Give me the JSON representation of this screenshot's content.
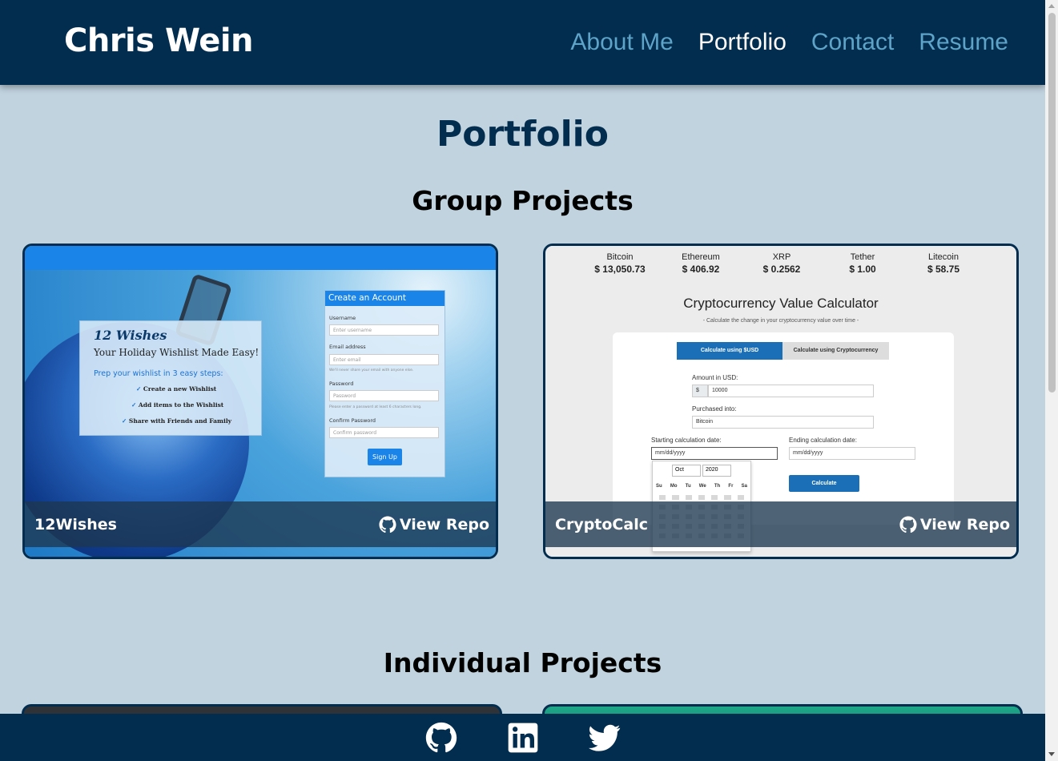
{
  "nav": {
    "brand": "Chris Wein",
    "links": [
      {
        "label": "About Me",
        "active": false
      },
      {
        "label": "Portfolio",
        "active": true
      },
      {
        "label": "Contact",
        "active": false
      },
      {
        "label": "Resume",
        "active": false
      }
    ]
  },
  "page_title": "Portfolio",
  "sections": {
    "group_title": "Group Projects",
    "individual_title": "Individual Projects"
  },
  "group_projects": [
    {
      "name": "12Wishes",
      "repo_label": "View Repo",
      "screenshot": {
        "logo": "12 Wishes",
        "tagline": "Your Holiday Wishlist Made Easy!",
        "steps_heading": "Prep your wishlist in 3 easy steps:",
        "steps": [
          "Create a new Wishlist",
          "Add items to the Wishlist",
          "Share with Friends and Family"
        ],
        "form_title": "Create an Account",
        "username_label": "Username",
        "username_placeholder": "Enter username",
        "email_label": "Email address",
        "email_placeholder": "Enter email",
        "email_help": "We'll never share your email with anyone else.",
        "password_label": "Password",
        "password_placeholder": "Password",
        "password_help": "Please enter a password at least 6 characters long.",
        "confirm_label": "Confirm Password",
        "confirm_placeholder": "Confirm password",
        "signup_button": "Sign Up"
      }
    },
    {
      "name": "CryptoCalc",
      "repo_label": "View Repo",
      "screenshot": {
        "tickers": [
          {
            "coin": "Bitcoin",
            "price": "$ 13,050.73"
          },
          {
            "coin": "Ethereum",
            "price": "$ 406.92"
          },
          {
            "coin": "XRP",
            "price": "$ 0.2562"
          },
          {
            "coin": "Tether",
            "price": "$ 1.00"
          },
          {
            "coin": "Litecoin",
            "price": "$ 58.75"
          }
        ],
        "title": "Cryptocurrency Value Calculator",
        "subtitle": "- Calculate the change in your cryptocurrency value over time -",
        "tab_usd": "Calculate using $USD",
        "tab_crypto": "Calculate using Cryptocurrency",
        "amount_label": "Amount in USD:",
        "currency_symbol": "$",
        "amount_value": "10000",
        "purchased_label": "Purchased into:",
        "purchased_value": "Bitcoin",
        "start_label": "Starting calculation date:",
        "start_value": "mm/dd/yyyy",
        "end_label": "Ending calculation date:",
        "end_value": "mm/dd/yyyy",
        "calc_button": "Calculate",
        "cal_month": "Oct",
        "cal_year": "2020",
        "cal_days": [
          "Su",
          "Mo",
          "Tu",
          "We",
          "Th",
          "Fr",
          "Sa"
        ]
      }
    }
  ],
  "footer": {
    "icons": [
      "github-icon",
      "linkedin-icon",
      "twitter-icon"
    ]
  },
  "colors": {
    "navy": "#022d4e",
    "background": "#c1d3df",
    "nav_link": "#5ea3c8",
    "accent_blue": "#1a84e8"
  }
}
